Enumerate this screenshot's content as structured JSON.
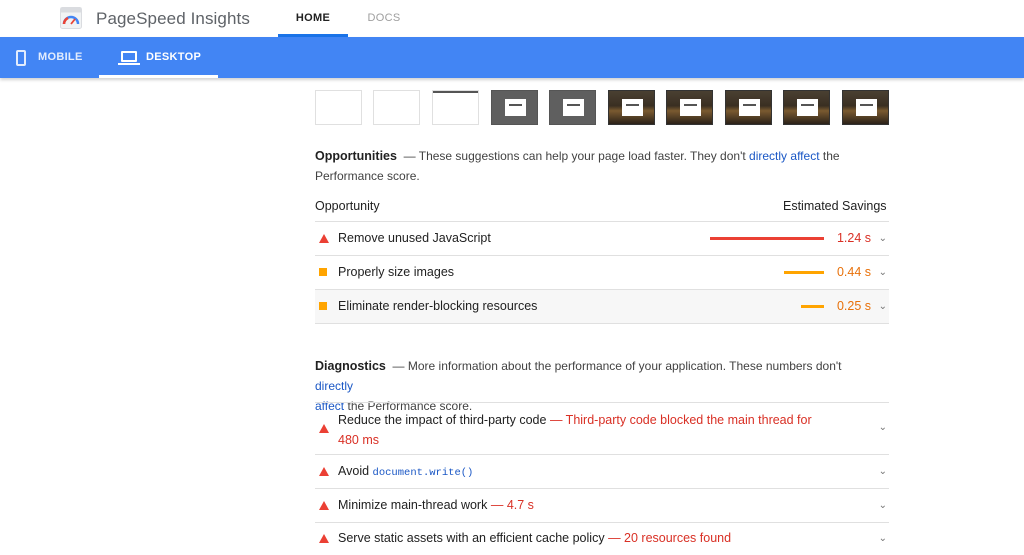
{
  "app": {
    "title": "PageSpeed Insights",
    "logo_icon": "pagespeed-gauge-icon",
    "nav": [
      {
        "label": "HOME",
        "active": true
      },
      {
        "label": "DOCS",
        "active": false
      }
    ]
  },
  "devices": [
    {
      "label": "MOBILE",
      "icon": "smartphone-icon",
      "active": false
    },
    {
      "label": "DESKTOP",
      "icon": "laptop-icon",
      "active": true
    }
  ],
  "colors": {
    "brand_blue": "#4285f4",
    "fail_red": "#eb4034",
    "average_orange": "#ffa400",
    "link_blue": "#1a57c5"
  },
  "opportunities": {
    "heading": "Opportunities",
    "description_before": "— These suggestions can help your page load faster. They don't",
    "description_link": "directly affect",
    "description_after": "the",
    "description_line2": "Performance score.",
    "col_opportunity": "Opportunity",
    "col_savings": "Estimated Savings",
    "items": [
      {
        "title": "Remove unused JavaScript",
        "savings": "1.24 s",
        "severity": "fail",
        "savings_seconds": 1.24
      },
      {
        "title": "Properly size images",
        "savings": "0.44 s",
        "severity": "average",
        "savings_seconds": 0.44
      },
      {
        "title": "Eliminate render-blocking resources",
        "savings": "0.25 s",
        "severity": "average",
        "savings_seconds": 0.25
      }
    ]
  },
  "diagnostics": {
    "heading": "Diagnostics",
    "description_before": "— More information about the performance of your application. These numbers don't",
    "description_link1": "directly",
    "description_link2": "affect",
    "description_after": "the Performance score.",
    "items": [
      {
        "title": "Reduce the impact of third-party code",
        "detail_line1": "— Third-party code blocked the main thread for",
        "detail_line2": "480 ms",
        "severity": "fail"
      },
      {
        "title": "Avoid",
        "code": "document.write()",
        "severity": "fail"
      },
      {
        "title": "Minimize main-thread work",
        "detail": "— 4.7 s",
        "severity": "fail"
      },
      {
        "title": "Serve static assets with an efficient cache policy",
        "detail": "— 20 resources found",
        "severity": "fail"
      }
    ]
  }
}
